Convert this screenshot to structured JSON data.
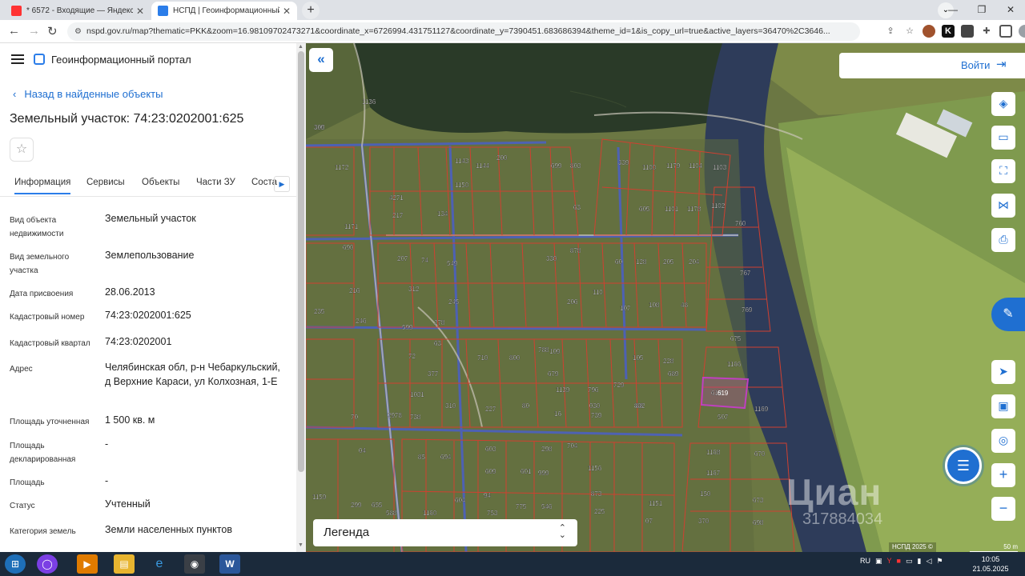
{
  "browser": {
    "tabs": [
      {
        "title": "* 6572 - Входящие — Яндекс По",
        "favicon_color": "#ff3333",
        "active": false
      },
      {
        "title": "НСПД | Геоинформационный п",
        "favicon_color": "#2b7de9",
        "active": true
      }
    ],
    "url": "nspd.gov.ru/map?thematic=PKK&zoom=16.98109702473271&coordinate_x=6726994.431751127&coordinate_y=7390451.683686394&theme_id=1&is_copy_url=true&active_layers=36470%2C3646..."
  },
  "sidebar": {
    "portal_title": "Геоинформационный портал",
    "back_link": "Назад в найденные объекты",
    "object_title": "Земельный участок: 74:23:0202001:625",
    "tabs": [
      "Информация",
      "Сервисы",
      "Объекты",
      "Части ЗУ",
      "Соста"
    ],
    "fields": [
      {
        "key": "Вид объекта недвижимости",
        "value": "Земельный участок"
      },
      {
        "key": "Вид земельного участка",
        "value": "Землепользование"
      },
      {
        "key": "Дата присвоения",
        "value": "28.06.2013"
      },
      {
        "key": "Кадастровый номер",
        "value": "74:23:0202001:625"
      },
      {
        "key": "Кадастровый квартал",
        "value": "74:23:0202001"
      },
      {
        "key": "Адрес",
        "value": "Челябинская обл, р-н Чебаркульский, д Верхние Караси, ул Колхозная, 1-Е"
      },
      {
        "key": "Площадь уточненная",
        "value": "1 500 кв. м"
      },
      {
        "key": "Площадь декларированная",
        "value": "-"
      },
      {
        "key": "Площадь",
        "value": "-"
      },
      {
        "key": "Статус",
        "value": "Учтенный"
      },
      {
        "key": "Категория земель",
        "value": "Земли населенных пунктов"
      }
    ]
  },
  "map": {
    "login_label": "Войти",
    "legend_label": "Легенда",
    "attribution": "НСПД 2025 ©",
    "scale_label": "50 m",
    "watermark": "Циан",
    "watermark_id": "317884034",
    "parcel_labels": [
      "338",
      "1172",
      "1136",
      "1143",
      "1144",
      "200",
      "699",
      "803",
      "339",
      "1100",
      "1179",
      "1104",
      "1103",
      "4271",
      "217",
      "1150",
      "134",
      "63",
      "605",
      "1101",
      "1178",
      "1102",
      "1171",
      "690",
      "207",
      "74",
      "549",
      "330",
      "878",
      "60",
      "128",
      "205",
      "204",
      "760",
      "216",
      "312",
      "245",
      "206",
      "110",
      "107",
      "108",
      "48",
      "767",
      "235",
      "246",
      "599",
      "278",
      "769",
      "72",
      "63",
      "710",
      "800",
      "788",
      "109",
      "105",
      "228",
      "675",
      "377",
      "679",
      "689",
      "1166",
      "1139",
      "796",
      "729",
      "030",
      "802",
      "619",
      "1031",
      "310",
      "227",
      "80",
      "16",
      "739",
      "88",
      "507",
      "1169",
      "70",
      "2978",
      "738",
      "04",
      "85",
      "694",
      "603",
      "298",
      "704",
      "1156",
      "1168",
      "670",
      "1167",
      "609",
      "601",
      "999",
      "873",
      "150",
      "673",
      "1159",
      "299",
      "655",
      "588",
      "604",
      "94",
      "753",
      "775",
      "546",
      "225",
      "1151",
      "370",
      "698",
      "1160",
      "007",
      "754",
      "07",
      "305"
    ],
    "selected_parcel": "619"
  },
  "taskbar": {
    "lang": "RU",
    "time": "10:05",
    "date": "21.05.2025"
  },
  "colors": {
    "accent": "#1f6fd1",
    "parcel_border": "#d04030",
    "selected_parcel": "#c040c0",
    "road_blue": "#4a5fc8"
  }
}
